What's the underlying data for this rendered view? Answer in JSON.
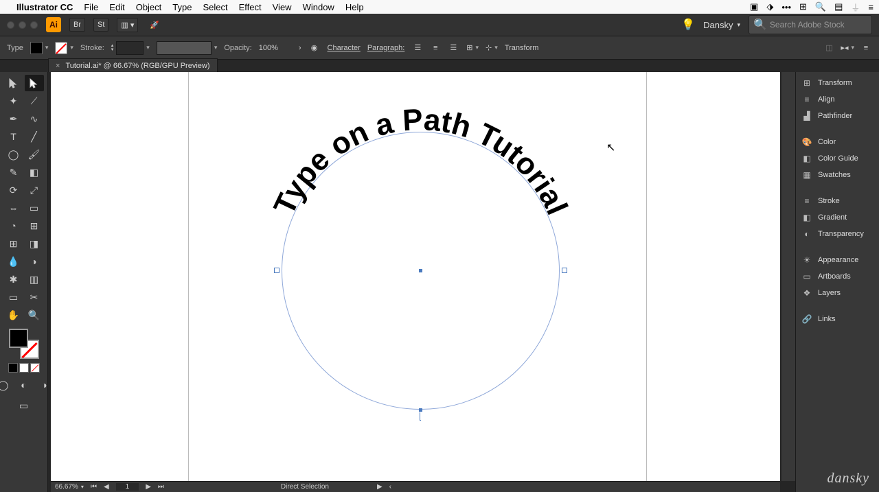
{
  "mac_menu": {
    "app": "Illustrator CC",
    "items": [
      "File",
      "Edit",
      "Object",
      "Type",
      "Select",
      "Effect",
      "View",
      "Window",
      "Help"
    ]
  },
  "header": {
    "user": "Dansky",
    "search_placeholder": "Search Adobe Stock"
  },
  "control_bar": {
    "label": "Type",
    "stroke_label": "Stroke:",
    "opacity_label": "Opacity:",
    "opacity_value": "100%",
    "character": "Character",
    "paragraph": "Paragraph:",
    "transform": "Transform"
  },
  "document": {
    "tab_title": "Tutorial.ai* @ 66.67% (RGB/GPU Preview)",
    "type_on_path_text": "Type on a Path Tutorial"
  },
  "status_bar": {
    "zoom": "66.67%",
    "page": "1",
    "tool": "Direct Selection"
  },
  "panels": {
    "items": [
      {
        "icon": "⊞",
        "label": "Transform"
      },
      {
        "icon": "≡",
        "label": "Align"
      },
      {
        "icon": "▟",
        "label": "Pathfinder"
      },
      {
        "gap": true
      },
      {
        "icon": "🎨",
        "label": "Color"
      },
      {
        "icon": "◧",
        "label": "Color Guide"
      },
      {
        "icon": "▦",
        "label": "Swatches"
      },
      {
        "gap": true
      },
      {
        "icon": "≡",
        "label": "Stroke"
      },
      {
        "icon": "◧",
        "label": "Gradient"
      },
      {
        "icon": "◐",
        "label": "Transparency"
      },
      {
        "gap": true
      },
      {
        "icon": "☀",
        "label": "Appearance"
      },
      {
        "icon": "▭",
        "label": "Artboards"
      },
      {
        "icon": "❖",
        "label": "Layers"
      },
      {
        "gap": true
      },
      {
        "icon": "🔗",
        "label": "Links"
      }
    ]
  },
  "watermark": "dansky"
}
